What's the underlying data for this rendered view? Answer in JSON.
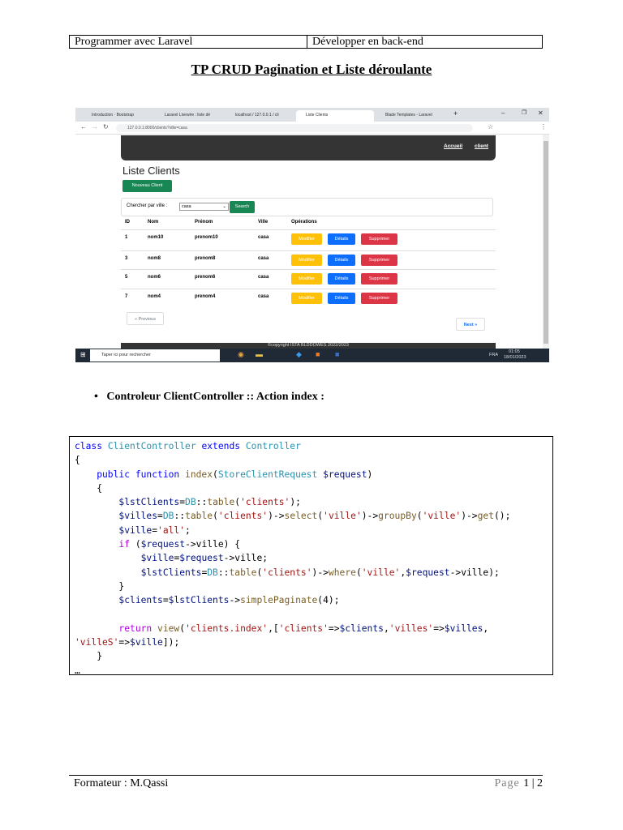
{
  "header": {
    "left": "Programmer avec Laravel",
    "right": "Développer en back-end"
  },
  "title": "TP CRUD Pagination et Liste déroulante ",
  "screenshot": {
    "tabs": [
      "Introduction · Bootstrap",
      "Laravel Livewire : liste dé",
      "localhost / 127.0.0.1 / cli",
      "Liste Clients",
      "Blade Templates - Laravel"
    ],
    "url": "127.0.0.1:8000/clients?ville=casa",
    "nav": {
      "home": "Accueil",
      "client": "client"
    },
    "page_title": "Liste Clients",
    "new_button": "Nouveau Client",
    "search_label": "Chercher par ville :",
    "search_value": "casa",
    "search_button": "Search",
    "columns": [
      "ID",
      "Nom",
      "Prénom",
      "Ville",
      "Opérations"
    ],
    "rows": [
      {
        "id": "1",
        "nom": "nom10",
        "prenom": "prenom10",
        "ville": "casa"
      },
      {
        "id": "3",
        "nom": "nom8",
        "prenom": "prenom8",
        "ville": "casa"
      },
      {
        "id": "5",
        "nom": "nom6",
        "prenom": "prenom6",
        "ville": "casa"
      },
      {
        "id": "7",
        "nom": "nom4",
        "prenom": "prenom4",
        "ville": "casa"
      }
    ],
    "actions": {
      "edit": "Modifier",
      "details": "Détails",
      "delete": "Supprimer"
    },
    "prev": "« Previous",
    "next": "Next »",
    "footer": "©copyright ISTA BLDDOWES 2022/2023",
    "taskbar": {
      "search": "Taper ici pour rechercher",
      "lang": "FRA",
      "time": "01:05",
      "date": "18/01/2023"
    }
  },
  "bullet": "Controleur ClientController :: Action index :",
  "code": [
    [
      [
        "class ",
        "kw"
      ],
      [
        "ClientController ",
        "cls"
      ],
      [
        "extends ",
        "kw"
      ],
      [
        "Controller",
        "cls"
      ]
    ],
    [
      [
        "{",
        "pl"
      ]
    ],
    [
      [
        "    public function ",
        "kw"
      ],
      [
        "index",
        "fn"
      ],
      [
        "(",
        "pl"
      ],
      [
        "StoreClientRequest ",
        "cls"
      ],
      [
        "$request",
        "var"
      ],
      [
        ")",
        "pl"
      ]
    ],
    [
      [
        "    {",
        "pl"
      ]
    ],
    [
      [
        "        $lstClients",
        "var"
      ],
      [
        "=",
        "pl"
      ],
      [
        "DB",
        "cls"
      ],
      [
        "::",
        "pl"
      ],
      [
        "table",
        "fn"
      ],
      [
        "(",
        "pl"
      ],
      [
        "'clients'",
        "str"
      ],
      [
        ");",
        "pl"
      ]
    ],
    [
      [
        "        $villes",
        "var"
      ],
      [
        "=",
        "pl"
      ],
      [
        "DB",
        "cls"
      ],
      [
        "::",
        "pl"
      ],
      [
        "table",
        "fn"
      ],
      [
        "(",
        "pl"
      ],
      [
        "'clients'",
        "str"
      ],
      [
        ")->",
        "pl"
      ],
      [
        "select",
        "fn"
      ],
      [
        "(",
        "pl"
      ],
      [
        "'ville'",
        "str"
      ],
      [
        ")->",
        "pl"
      ],
      [
        "groupBy",
        "fn"
      ],
      [
        "(",
        "pl"
      ],
      [
        "'ville'",
        "str"
      ],
      [
        ")->",
        "pl"
      ],
      [
        "get",
        "fn"
      ],
      [
        "();",
        "pl"
      ]
    ],
    [
      [
        "        $ville",
        "var"
      ],
      [
        "=",
        "pl"
      ],
      [
        "'all'",
        "str"
      ],
      [
        ";",
        "pl"
      ]
    ],
    [
      [
        "        if ",
        "ctl"
      ],
      [
        "(",
        "pl"
      ],
      [
        "$request",
        "var"
      ],
      [
        "->ville) {",
        "pl"
      ]
    ],
    [
      [
        "            $ville",
        "var"
      ],
      [
        "=",
        "pl"
      ],
      [
        "$request",
        "var"
      ],
      [
        "->ville;",
        "pl"
      ]
    ],
    [
      [
        "            $lstClients",
        "var"
      ],
      [
        "=",
        "pl"
      ],
      [
        "DB",
        "cls"
      ],
      [
        "::",
        "pl"
      ],
      [
        "table",
        "fn"
      ],
      [
        "(",
        "pl"
      ],
      [
        "'clients'",
        "str"
      ],
      [
        ")->",
        "pl"
      ],
      [
        "where",
        "fn"
      ],
      [
        "(",
        "pl"
      ],
      [
        "'ville'",
        "str"
      ],
      [
        ",",
        "pl"
      ],
      [
        "$request",
        "var"
      ],
      [
        "->ville);",
        "pl"
      ]
    ],
    [
      [
        "        }",
        "pl"
      ]
    ],
    [
      [
        "        $clients",
        "var"
      ],
      [
        "=",
        "pl"
      ],
      [
        "$lstClients",
        "var"
      ],
      [
        "->",
        "pl"
      ],
      [
        "simplePaginate",
        "fn"
      ],
      [
        "(4);",
        "pl"
      ]
    ],
    [
      [
        "",
        "pl"
      ]
    ],
    [
      [
        "        return ",
        "ctl"
      ],
      [
        "view",
        "fn"
      ],
      [
        "(",
        "pl"
      ],
      [
        "'clients.index'",
        "str"
      ],
      [
        ",[",
        "pl"
      ],
      [
        "'clients'",
        "str"
      ],
      [
        "=>",
        "pl"
      ],
      [
        "$clients",
        "var"
      ],
      [
        ",",
        "pl"
      ],
      [
        "'villes'",
        "str"
      ],
      [
        "=>",
        "pl"
      ],
      [
        "$villes",
        "var"
      ],
      [
        ",",
        "pl"
      ]
    ],
    [
      [
        "'villeS'",
        "str"
      ],
      [
        "=>",
        "pl"
      ],
      [
        "$ville",
        "var"
      ],
      [
        "]);",
        "pl"
      ]
    ],
    [
      [
        "    }",
        "pl"
      ]
    ],
    [
      [
        "…",
        "pl"
      ]
    ]
  ],
  "footer": {
    "left": "Formateur : M.Qassi",
    "page_label": "Page ",
    "page": "1",
    "sep": " | ",
    "total": "2"
  }
}
